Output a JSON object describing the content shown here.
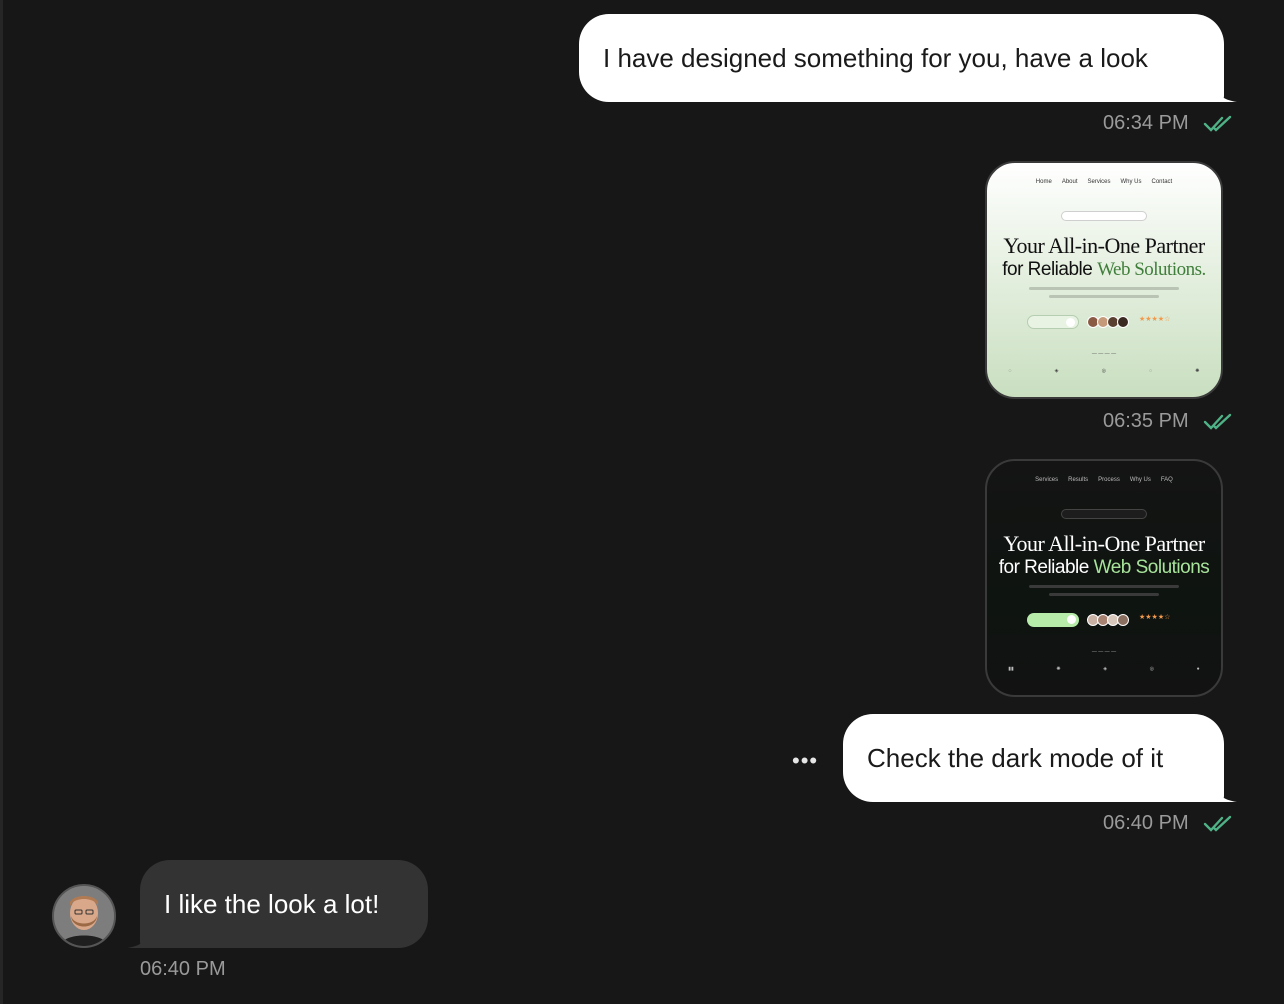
{
  "messages": {
    "m1": {
      "text": "I have designed something for you, have a look",
      "time": "06:34 PM"
    },
    "m2": {
      "time": "06:35 PM"
    },
    "m4": {
      "text": "Check the dark mode of it",
      "time": "06:40 PM"
    },
    "m5": {
      "text": "I like the look a lot!",
      "time": "06:40 PM"
    }
  },
  "preview_light": {
    "nav": [
      "Home",
      "About",
      "Services",
      "Why Us",
      "Contact"
    ],
    "hero_line1": "Your All-in-One Partner",
    "hero_line2_plain": "for Reliable",
    "hero_line2_accent": "Web Solutions."
  },
  "preview_dark": {
    "nav": [
      "Services",
      "Results",
      "Process",
      "Why Us",
      "FAQ"
    ],
    "hero_line1": "Your All-in-One Partner",
    "hero_line2_plain": "for Reliable",
    "hero_line2_accent": "Web Solutions"
  },
  "icons": {
    "read_receipt": "double-check-icon",
    "more_options": "more-dots-icon"
  },
  "colors": {
    "background": "#171717",
    "outgoing_bubble": "#ffffff",
    "incoming_bubble": "#333333",
    "read_check": "#4fb286",
    "timestamp": "#9a9a9a"
  }
}
